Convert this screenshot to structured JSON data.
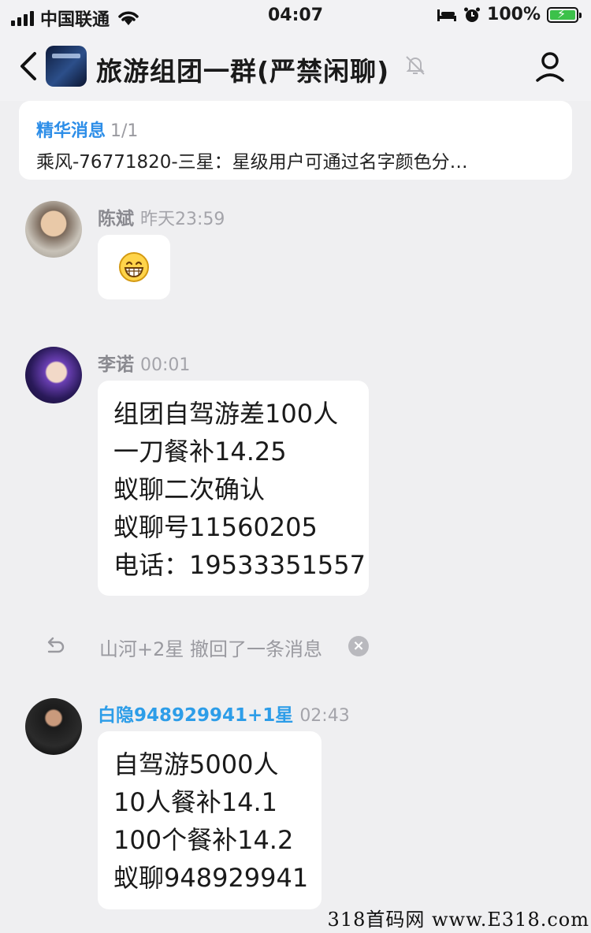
{
  "status_bar": {
    "carrier": "中国联通",
    "time": "04:07",
    "battery": "100%"
  },
  "header": {
    "title": "旅游组团一群(严禁闲聊)"
  },
  "essence": {
    "label": "精华消息",
    "count": "1/1",
    "text": "乘风-76771820-三星：星级用户可通过名字颜色分…"
  },
  "messages": [
    {
      "name": "陈斌",
      "time": "昨天23:59",
      "content": "😁"
    },
    {
      "name": "李诺",
      "time": "00:01",
      "lines": [
        "组团自驾游差100人",
        "一刀餐补14.25",
        "蚁聊二次确认",
        "蚁聊号11560205",
        "电话：19533351557"
      ]
    },
    {
      "name": "白隐948929941+1星",
      "time": "02:43",
      "lines": [
        "自驾游5000人",
        "10人餐补14.1",
        "100个餐补14.2",
        "蚁聊948929941"
      ]
    }
  ],
  "recall": {
    "text": "山河+2星 撤回了一条消息"
  },
  "watermark": "318首码网 www.E318.com",
  "colors": {
    "accent": "#2d8ee8",
    "background": "#efeff1"
  }
}
